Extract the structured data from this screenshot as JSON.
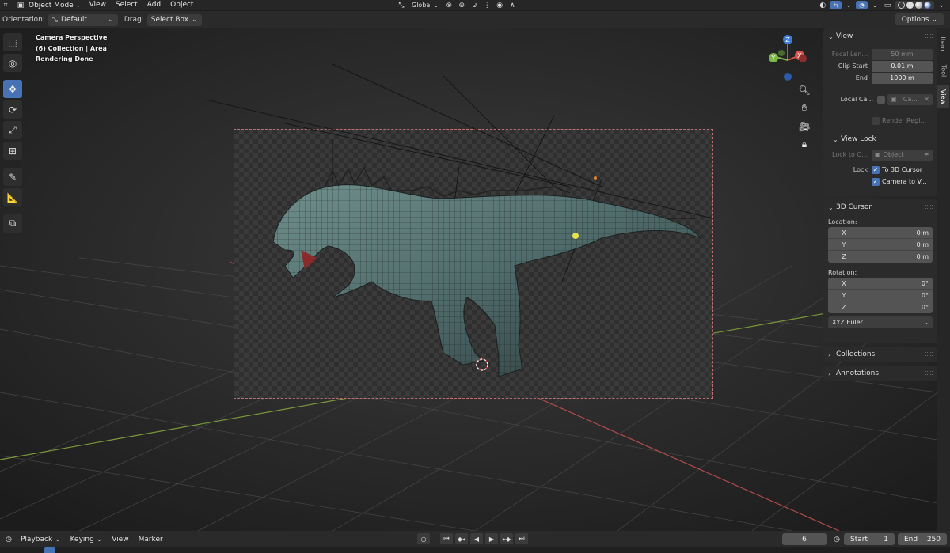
{
  "header": {
    "mode": "Object Mode",
    "menus": [
      "View",
      "Select",
      "Add",
      "Object"
    ],
    "transform_orientation": "Global"
  },
  "tool_settings": {
    "orientation_label": "Orientation:",
    "orientation_value": "Default",
    "drag_label": "Drag:",
    "drag_value": "Select Box",
    "options_label": "Options"
  },
  "viewport": {
    "overlay": [
      "Camera Perspective",
      "(6) Collection | Area",
      "Rendering Done"
    ],
    "gizmo": {
      "x": "X",
      "y": "Y",
      "z": "Z"
    }
  },
  "npanel": {
    "tabs": [
      "Item",
      "Tool",
      "View"
    ],
    "active_tab": "View",
    "view": {
      "title": "View",
      "focal_length_label": "Focal Len...",
      "focal_length_value": "50 mm",
      "clip_start_label": "Clip Start",
      "clip_start_value": "0.01 m",
      "end_label": "End",
      "end_value": "1000 m",
      "local_camera_label": "Local Ca...",
      "local_camera_value": "Ca...",
      "render_region_label": "Render Regi...",
      "view_lock_title": "View Lock",
      "lock_to_object_label": "Lock to O...",
      "lock_to_object_value": "Object",
      "lock_label": "Lock",
      "to_3d_cursor_label": "To 3D Cursor",
      "camera_to_view_label": "Camera to V..."
    },
    "cursor": {
      "title": "3D Cursor",
      "location_label": "Location:",
      "location": [
        {
          "axis": "X",
          "value": "0 m"
        },
        {
          "axis": "Y",
          "value": "0 m"
        },
        {
          "axis": "Z",
          "value": "0 m"
        }
      ],
      "rotation_label": "Rotation:",
      "rotation": [
        {
          "axis": "X",
          "value": "0°"
        },
        {
          "axis": "Y",
          "value": "0°"
        },
        {
          "axis": "Z",
          "value": "0°"
        }
      ],
      "rotation_mode": "XYZ Euler"
    },
    "collections_title": "Collections",
    "annotations_title": "Annotations"
  },
  "timeline": {
    "menus": [
      "Playback",
      "Keying",
      "View",
      "Marker"
    ],
    "current_frame": "6",
    "start_label": "Start",
    "start_value": "1",
    "end_label": "End",
    "end_value": "250"
  },
  "colors": {
    "accent": "#4772b3",
    "x_axis": "#d9534f",
    "y_axis": "#7ab648",
    "z_axis": "#3d7dd8"
  }
}
